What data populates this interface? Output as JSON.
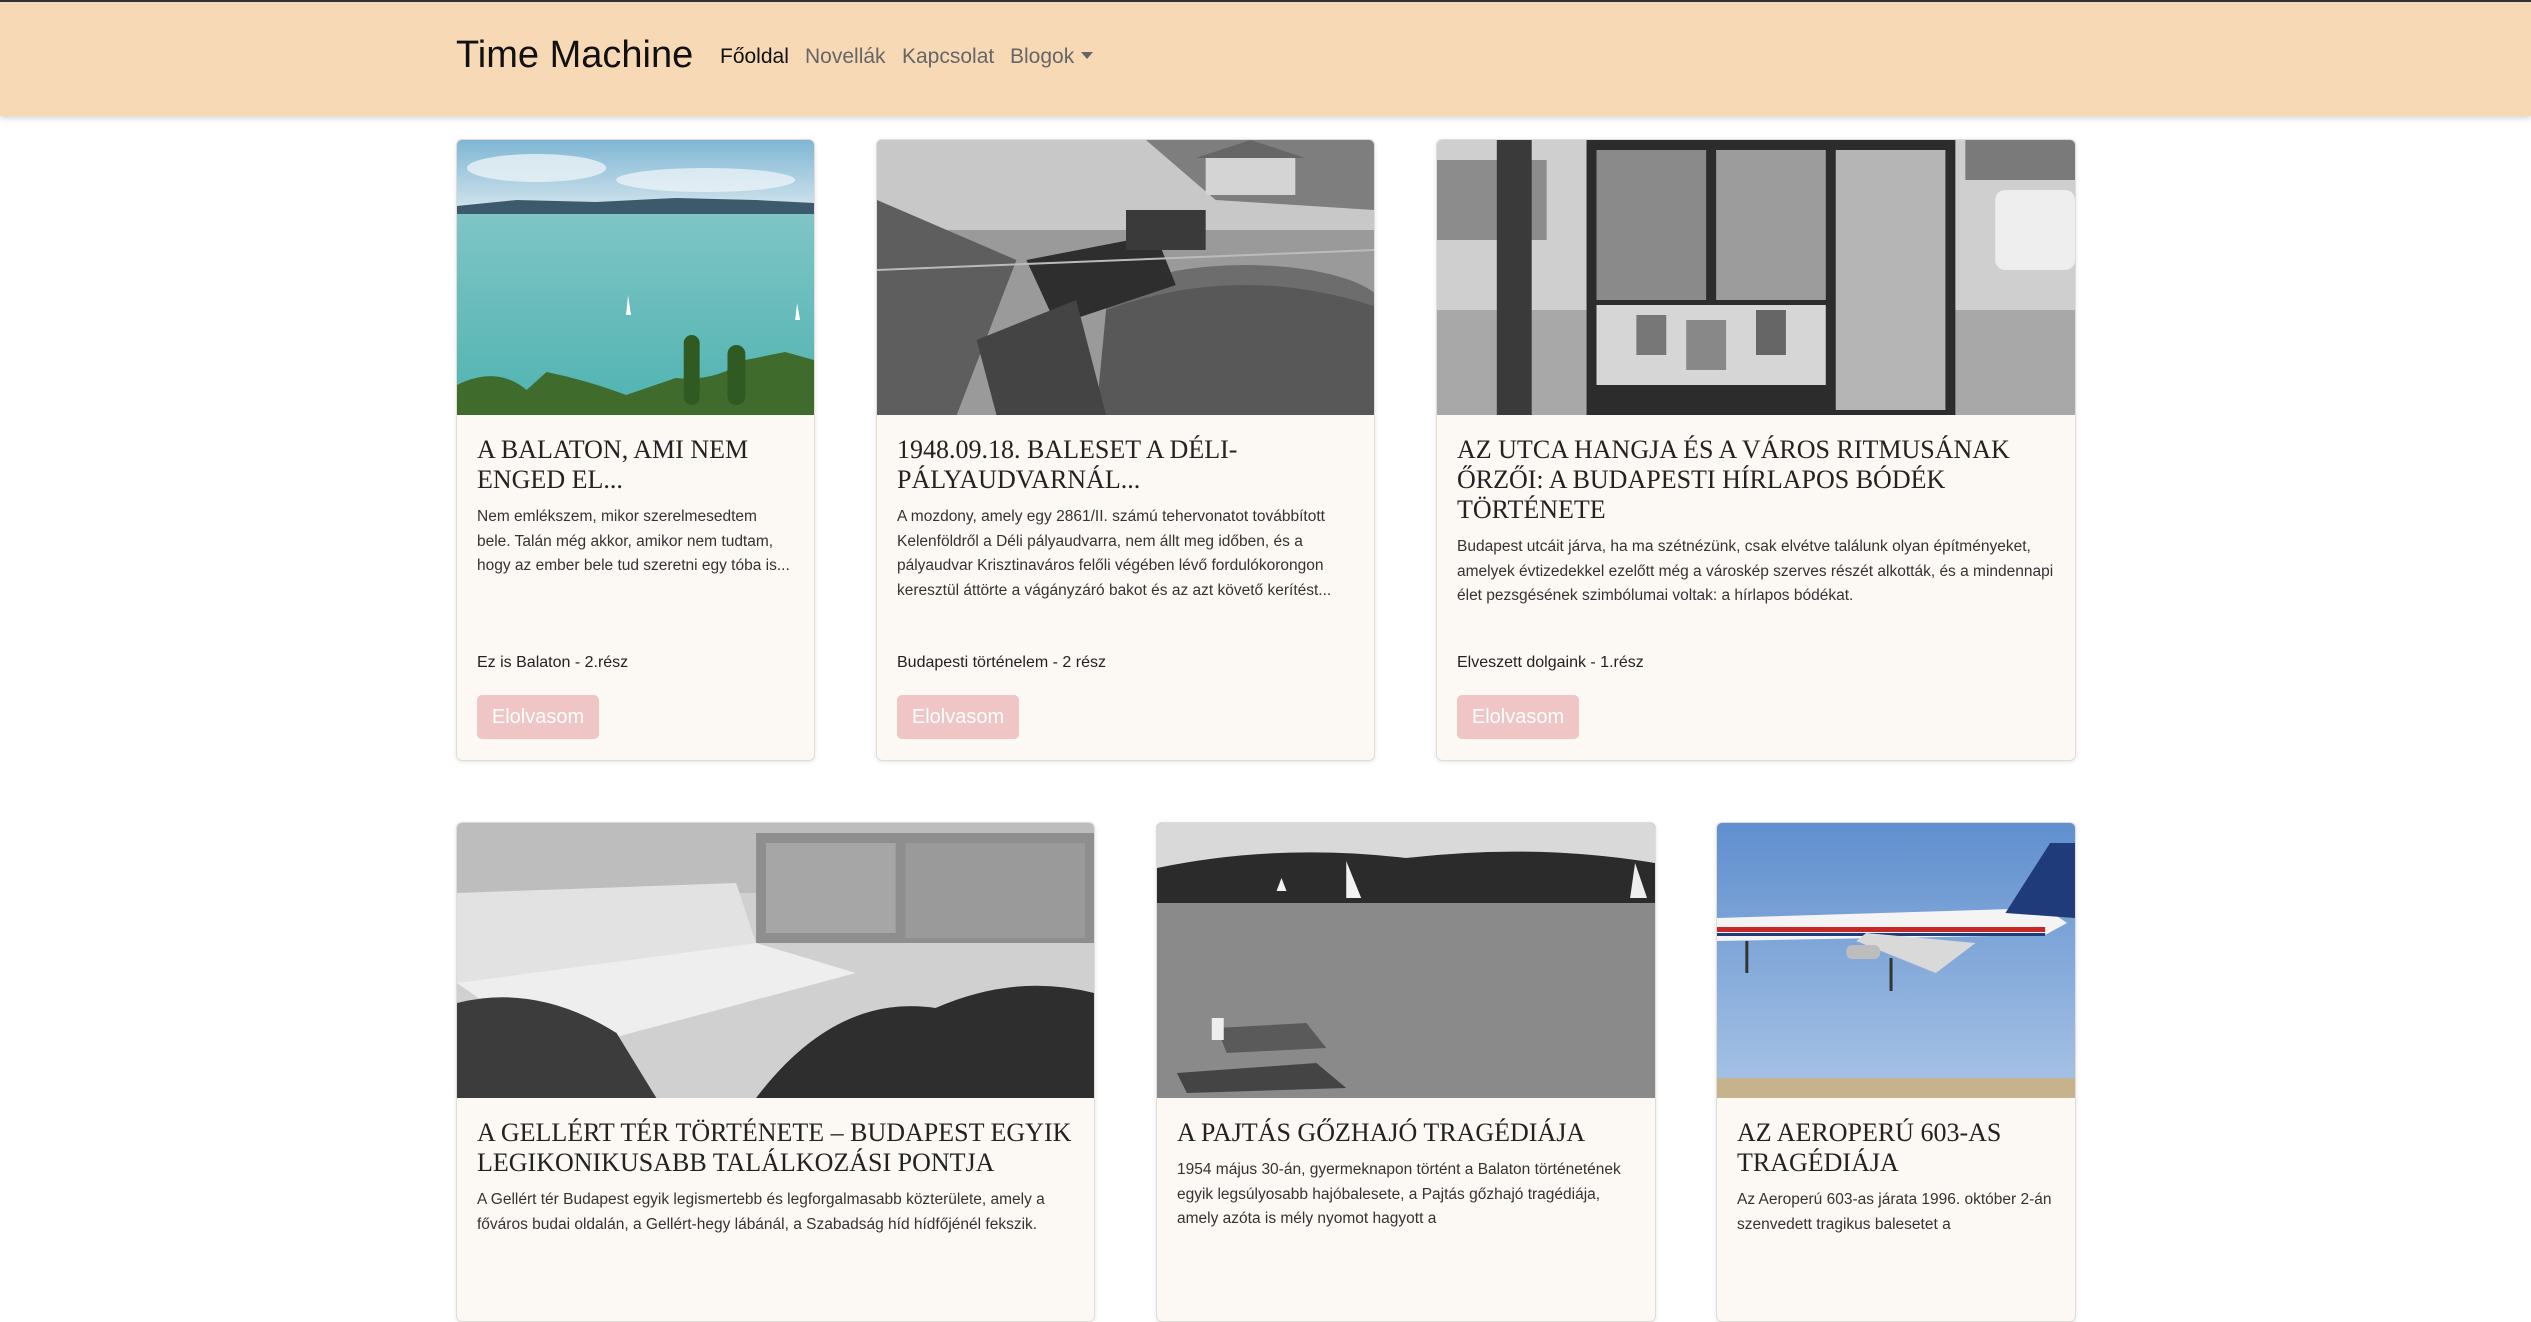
{
  "navbar": {
    "brand": "Time Machine",
    "links": [
      "Főoldal",
      "Novellák",
      "Kapcsolat",
      "Blogok"
    ]
  },
  "cards": [
    {
      "title": "A Balaton, ami nem enged el...",
      "excerpt": "Nem emlékszem, mikor szerelmesedtem bele. Talán még akkor, amikor nem tudtam, hogy az ember bele tud szeretni egy tóba is...",
      "series": "Ez is Balaton - 2.rész",
      "button": "Elolvasom"
    },
    {
      "title": "1948.09.18. Baleset a Déli-pályaudvarnál...",
      "excerpt": "A mozdony, amely egy 2861/II. számú tehervonatot továbbított Kelenföldről a Déli pályaudvarra, nem állt meg időben, és a pályaudvar Krisztinaváros felőli végében lévő fordulókorongon keresztül áttörte a vágányzáró bakot és az azt követő kerítést...",
      "series": "Budapesti történelem - 2 rész",
      "button": "Elolvasom"
    },
    {
      "title": "Az utca hangja és a város ritmusának őrzői: A budapesti hírlapos bódék története",
      "excerpt": "Budapest utcáit járva, ha ma szétnézünk, csak elvétve találunk olyan építményeket, amelyek évtizedekkel ezelőtt még a városkép szerves részét alkották, és a mindennapi élet pezsgésének szimbólumai voltak: a hírlapos bódékat.",
      "series": "Elveszett dolgaink - 1.rész",
      "button": "Elolvasom"
    },
    {
      "title": "A Gellért tér története – Budapest egyik legikonikusabb találkozási pontja",
      "excerpt": "A Gellért tér Budapest egyik legismertebb és legforgalmasabb közterülete, amely a főváros budai oldalán, a Gellért-hegy lábánál, a Szabadság híd hídfőjénél fekszik."
    },
    {
      "title": "A Pajtás gőzhajó tragédiája",
      "excerpt": "1954 május 30-án, gyermeknapon történt a Balaton történetének egyik legsúlyosabb hajóbalesete, a Pajtás gőzhajó tragédiája, amely azóta is mély nyomot hagyott a"
    },
    {
      "title": "Az Aeroperú 603-as tragédiája",
      "excerpt": "Az Aeroperú 603-as járata 1996. október 2-án szenvedett tragikus balesetet a"
    }
  ],
  "colors": {
    "navbar_bg": "#f8d9b5",
    "card_bg": "#fcf8f4",
    "button_bg": "#efc5c5"
  }
}
